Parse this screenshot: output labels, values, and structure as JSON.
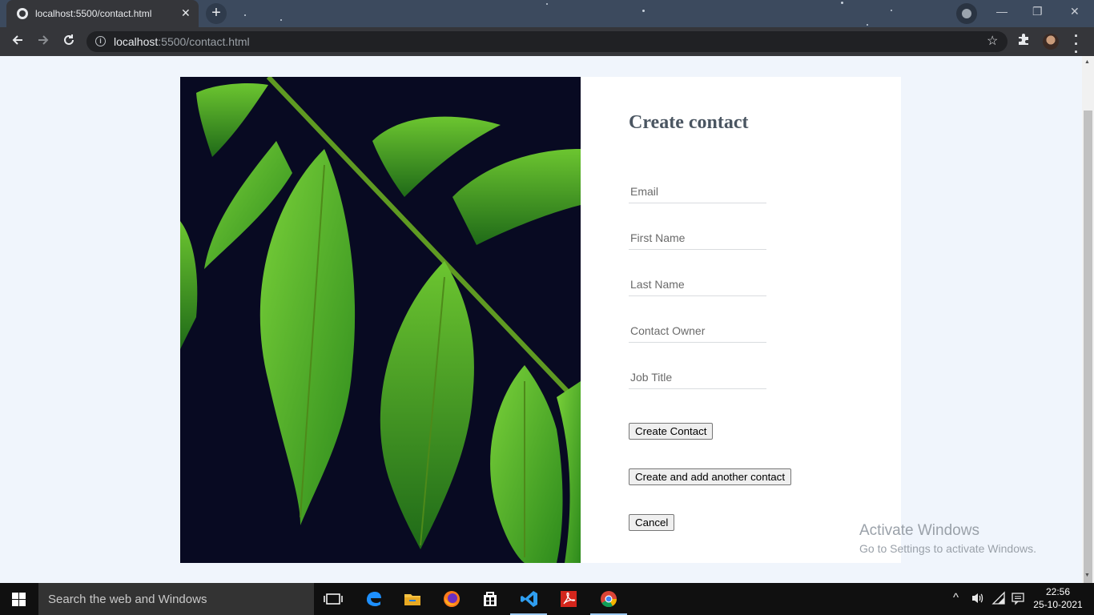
{
  "browser": {
    "tab_title": "localhost:5500/contact.html",
    "tab_close": "✕",
    "new_tab": "+",
    "url_host": "localhost",
    "url_path": ":5500/contact.html",
    "window_controls": {
      "minimize": "—",
      "restore": "❐",
      "close": "✕"
    }
  },
  "page": {
    "heading": "Create contact",
    "fields": [
      {
        "placeholder": "Email",
        "value": ""
      },
      {
        "placeholder": "First Name",
        "value": ""
      },
      {
        "placeholder": "Last Name",
        "value": ""
      },
      {
        "placeholder": "Contact Owner",
        "value": ""
      },
      {
        "placeholder": "Job Title",
        "value": ""
      }
    ],
    "buttons": {
      "create": "Create Contact",
      "create_another": "Create and add another contact",
      "cancel": "Cancel"
    },
    "image_subject": "green fern leaf on dark background"
  },
  "watermark": {
    "line1": "Activate Windows",
    "line2": "Go to Settings to activate Windows."
  },
  "taskbar": {
    "search_placeholder": "Search the web and Windows",
    "time": "22:56",
    "date": "25-10-2021",
    "apps": [
      "task-view",
      "edge",
      "file-explorer",
      "firefox",
      "store",
      "vscode",
      "acrobat",
      "chrome"
    ]
  },
  "colors": {
    "page_bg": "#f0f5fc",
    "heading": "#4a5561",
    "chrome_dark": "#35363a"
  }
}
